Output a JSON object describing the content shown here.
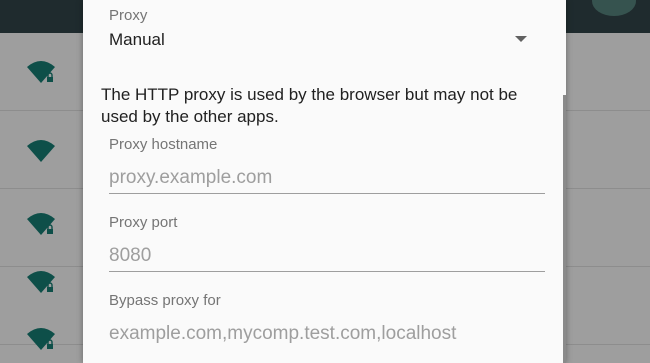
{
  "colors": {
    "wifi_icon": "#0e4f49",
    "dialog_background": "#fafafa",
    "top_bar": "#1f2b2e"
  },
  "proxy": {
    "label": "Proxy",
    "selected": "Manual",
    "arrow_icon": "arrow-drop-down-icon"
  },
  "info_text": "The HTTP proxy is used by the browser but may not be used by the other apps.",
  "hostname": {
    "label": "Proxy hostname",
    "value": "",
    "placeholder": "proxy.example.com"
  },
  "port": {
    "label": "Proxy port",
    "value": "",
    "placeholder": "8080"
  },
  "bypass": {
    "label": "Bypass proxy for",
    "value": "",
    "placeholder": "example.com,mycomp.test.com,localhost"
  },
  "background_networks": [
    {
      "icon": "wifi-locked-icon"
    },
    {
      "icon": "wifi-icon"
    },
    {
      "icon": "wifi-locked-icon"
    },
    {
      "icon": "wifi-locked-icon"
    },
    {
      "icon": "wifi-locked-icon"
    }
  ]
}
